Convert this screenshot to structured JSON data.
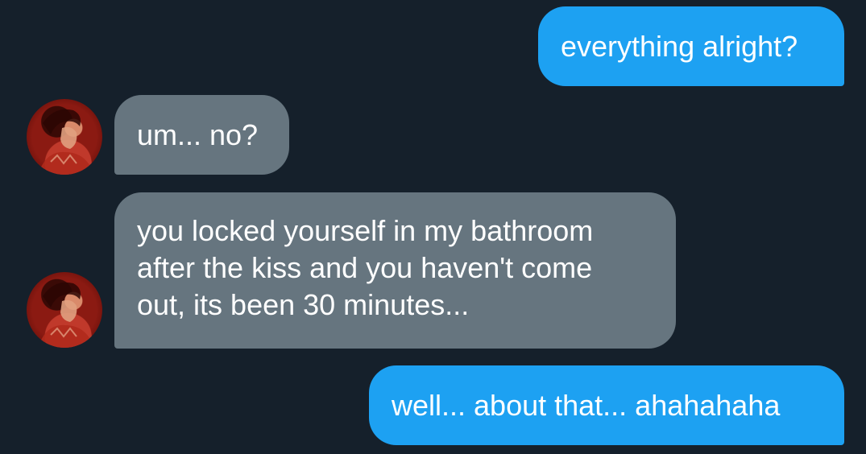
{
  "conversation": {
    "messages": [
      {
        "sender": "me",
        "text": "everything alright?"
      },
      {
        "sender": "them",
        "text": "um... no?"
      },
      {
        "sender": "them",
        "text": "you locked yourself in my bathroom\nafter the kiss and you haven't come\nout, its been 30 minutes..."
      },
      {
        "sender": "me",
        "text": "well... about that... ahahahaha"
      }
    ]
  },
  "colors": {
    "background": "#15202b",
    "sent_bubble": "#1da1f2",
    "received_bubble": "#66757f",
    "text": "#ffffff"
  },
  "icons": {
    "avatar": "user-avatar-photo"
  }
}
